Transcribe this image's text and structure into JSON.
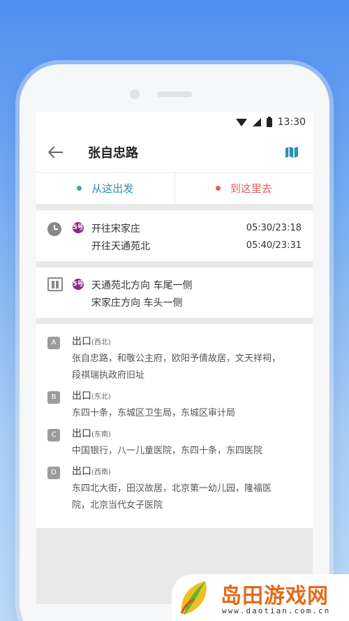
{
  "status_bar": {
    "time": "13:30"
  },
  "header": {
    "title": "张自忠路"
  },
  "actions": {
    "depart_label": "从这出发",
    "arrive_label": "到这里去",
    "depart_color": "#2ab58a",
    "arrive_color": "#e3605a"
  },
  "timetable": {
    "line_badge": "5号",
    "rows": [
      {
        "direction": "开往宋家庄",
        "time": "05:30/23:18"
      },
      {
        "direction": "开往天通苑北",
        "time": "05:40/23:31"
      }
    ]
  },
  "boarding": {
    "line_badge": "5号",
    "rows": [
      {
        "text": "天通苑北方向 车尾一侧"
      },
      {
        "text": "宋家庄方向 车头一侧"
      }
    ]
  },
  "exits": [
    {
      "letter": "A",
      "label": "出口",
      "direction": "(西北)",
      "desc": "张自忠路，和敬公主府，欧阳予倩故居，文天祥祠，段祺瑞执政府旧址"
    },
    {
      "letter": "B",
      "label": "出口",
      "direction": "(东北)",
      "desc": "东四十条，东城区卫生局，东城区审计局"
    },
    {
      "letter": "C",
      "label": "出口",
      "direction": "(东南)",
      "desc": "中国银行，八一儿童医院，东四十条，东四医院"
    },
    {
      "letter": "D",
      "label": "出口",
      "direction": "(西南)",
      "desc": "东四北大街，田汉故居，北京第一幼儿园，隆福医院，北京当代女子医院"
    }
  ],
  "watermark": {
    "title": "岛田游戏网",
    "url": "www.daotian.com.cn"
  }
}
